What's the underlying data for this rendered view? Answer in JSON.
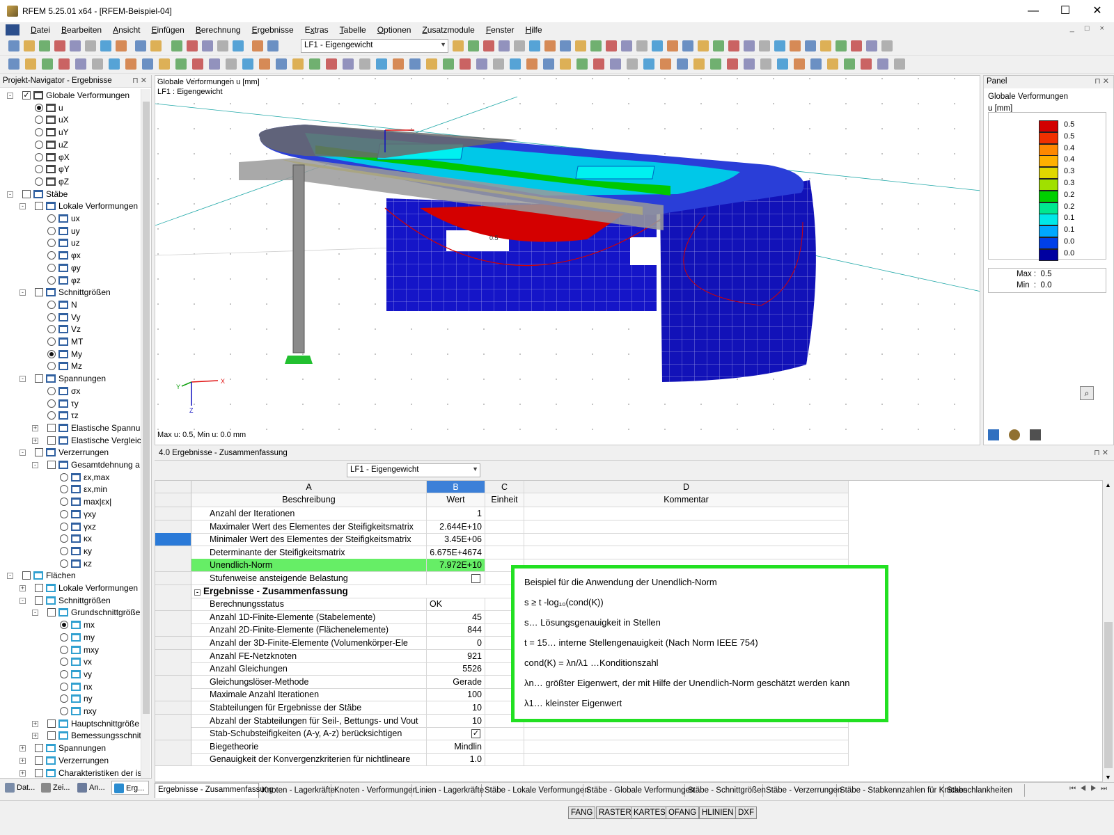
{
  "window": {
    "title": "RFEM 5.25.01 x64 - [RFEM-Beispiel-04]",
    "buttons": [
      "—",
      "☐",
      "✕"
    ]
  },
  "menu": [
    "Datei",
    "Bearbeiten",
    "Ansicht",
    "Einfügen",
    "Berechnung",
    "Ergebnisse",
    "Extras",
    "Tabelle",
    "Optionen",
    "Zusatzmodule",
    "Fenster",
    "Hilfe"
  ],
  "menu_underline": [
    "D",
    "B",
    "A",
    "E",
    "B",
    "E",
    "x",
    "T",
    "O",
    "Z",
    "F",
    "H"
  ],
  "toolbar": {
    "loadcase": "LF1 - Eigengewicht"
  },
  "navigator": {
    "title": "Projekt-Navigator - Ergebnisse",
    "tree": [
      {
        "level": 0,
        "kind": "chk",
        "checked": true,
        "expand": "-",
        "label": "Globale Verformungen",
        "icon": "deform"
      },
      {
        "level": 1,
        "kind": "rad",
        "on": true,
        "label": "u",
        "icon": "deform"
      },
      {
        "level": 1,
        "kind": "rad",
        "label": "uX",
        "icon": "deform"
      },
      {
        "level": 1,
        "kind": "rad",
        "label": "uY",
        "icon": "deform"
      },
      {
        "level": 1,
        "kind": "rad",
        "label": "uZ",
        "icon": "deform"
      },
      {
        "level": 1,
        "kind": "rad",
        "label": "φX",
        "icon": "deform"
      },
      {
        "level": 1,
        "kind": "rad",
        "label": "φY",
        "icon": "deform"
      },
      {
        "level": 1,
        "kind": "rad",
        "label": "φZ",
        "icon": "deform"
      },
      {
        "level": 0,
        "kind": "chk",
        "expand": "-",
        "label": "Stäbe",
        "icon": "member"
      },
      {
        "level": 1,
        "kind": "chk",
        "expand": "-",
        "label": "Lokale Verformungen",
        "icon": "member"
      },
      {
        "level": 2,
        "kind": "rad",
        "label": "ux",
        "icon": "member"
      },
      {
        "level": 2,
        "kind": "rad",
        "label": "uy",
        "icon": "member"
      },
      {
        "level": 2,
        "kind": "rad",
        "label": "uz",
        "icon": "member"
      },
      {
        "level": 2,
        "kind": "rad",
        "label": "φx",
        "icon": "member"
      },
      {
        "level": 2,
        "kind": "rad",
        "label": "φy",
        "icon": "member"
      },
      {
        "level": 2,
        "kind": "rad",
        "label": "φz",
        "icon": "member"
      },
      {
        "level": 1,
        "kind": "chk",
        "expand": "-",
        "label": "Schnittgrößen",
        "icon": "member"
      },
      {
        "level": 2,
        "kind": "rad",
        "label": "N",
        "icon": "member"
      },
      {
        "level": 2,
        "kind": "rad",
        "label": "Vy",
        "icon": "member"
      },
      {
        "level": 2,
        "kind": "rad",
        "label": "Vz",
        "icon": "member"
      },
      {
        "level": 2,
        "kind": "rad",
        "label": "MT",
        "icon": "member"
      },
      {
        "level": 2,
        "kind": "rad",
        "on": true,
        "label": "My",
        "icon": "member"
      },
      {
        "level": 2,
        "kind": "rad",
        "label": "Mz",
        "icon": "member"
      },
      {
        "level": 1,
        "kind": "chk",
        "expand": "-",
        "label": "Spannungen",
        "icon": "member"
      },
      {
        "level": 2,
        "kind": "rad",
        "label": "σx",
        "icon": "member"
      },
      {
        "level": 2,
        "kind": "rad",
        "label": "τy",
        "icon": "member"
      },
      {
        "level": 2,
        "kind": "rad",
        "label": "τz",
        "icon": "member"
      },
      {
        "level": 2,
        "kind": "chk",
        "expand": "+",
        "label": "Elastische Spannun",
        "icon": "member"
      },
      {
        "level": 2,
        "kind": "chk",
        "expand": "+",
        "label": "Elastische Vergleic",
        "icon": "member"
      },
      {
        "level": 1,
        "kind": "chk",
        "expand": "-",
        "label": "Verzerrungen",
        "icon": "member"
      },
      {
        "level": 2,
        "kind": "chk",
        "expand": "-",
        "label": "Gesamtdehnung a",
        "icon": "member"
      },
      {
        "level": 3,
        "kind": "rad",
        "label": "εx,max",
        "icon": "member"
      },
      {
        "level": 3,
        "kind": "rad",
        "label": "εx,min",
        "icon": "member"
      },
      {
        "level": 3,
        "kind": "rad",
        "label": "max|εx|",
        "icon": "member"
      },
      {
        "level": 3,
        "kind": "rad",
        "label": "γxy",
        "icon": "member"
      },
      {
        "level": 3,
        "kind": "rad",
        "label": "γxz",
        "icon": "member"
      },
      {
        "level": 3,
        "kind": "rad",
        "label": "κx",
        "icon": "member"
      },
      {
        "level": 3,
        "kind": "rad",
        "label": "κy",
        "icon": "member"
      },
      {
        "level": 3,
        "kind": "rad",
        "label": "κz",
        "icon": "member"
      },
      {
        "level": 0,
        "kind": "chk",
        "expand": "-",
        "label": "Flächen",
        "icon": "surface"
      },
      {
        "level": 1,
        "kind": "chk",
        "expand": "+",
        "label": "Lokale Verformungen",
        "icon": "surface"
      },
      {
        "level": 1,
        "kind": "chk",
        "expand": "-",
        "label": "Schnittgrößen",
        "icon": "surface"
      },
      {
        "level": 2,
        "kind": "chk",
        "expand": "-",
        "label": "Grundschnittgröße",
        "icon": "surface"
      },
      {
        "level": 3,
        "kind": "rad",
        "on": true,
        "label": "mx",
        "icon": "surface"
      },
      {
        "level": 3,
        "kind": "rad",
        "label": "my",
        "icon": "surface"
      },
      {
        "level": 3,
        "kind": "rad",
        "label": "mxy",
        "icon": "surface"
      },
      {
        "level": 3,
        "kind": "rad",
        "label": "vx",
        "icon": "surface"
      },
      {
        "level": 3,
        "kind": "rad",
        "label": "vy",
        "icon": "surface"
      },
      {
        "level": 3,
        "kind": "rad",
        "label": "nx",
        "icon": "surface"
      },
      {
        "level": 3,
        "kind": "rad",
        "label": "ny",
        "icon": "surface"
      },
      {
        "level": 3,
        "kind": "rad",
        "label": "nxy",
        "icon": "surface"
      },
      {
        "level": 2,
        "kind": "chk",
        "expand": "+",
        "label": "Hauptschnittgröße",
        "icon": "surface"
      },
      {
        "level": 2,
        "kind": "chk",
        "expand": "+",
        "label": "Bemessungsschnit",
        "icon": "surface"
      },
      {
        "level": 1,
        "kind": "chk",
        "expand": "+",
        "label": "Spannungen",
        "icon": "surface"
      },
      {
        "level": 1,
        "kind": "chk",
        "expand": "+",
        "label": "Verzerrungen",
        "icon": "surface"
      },
      {
        "level": 1,
        "kind": "chk",
        "expand": "+",
        "label": "Charakteristiken der is",
        "icon": "surface"
      }
    ],
    "tabs": [
      "Dat...",
      "Zei...",
      "An...",
      "Erg..."
    ]
  },
  "viewport": {
    "title": "Globale Verformungen u [mm]",
    "subtitle": "LF1 : Eigengewicht",
    "footer": "Max u: 0.5, Min u: 0.0 mm",
    "axes": [
      "X",
      "Y",
      "Z"
    ],
    "center_label": "0.5"
  },
  "panel": {
    "title": "Panel",
    "heading": "Globale Verformungen",
    "unit": "u [mm]",
    "legend": [
      {
        "value": "0.5",
        "color": "#d20000"
      },
      {
        "value": "0.5",
        "color": "#f03000"
      },
      {
        "value": "0.4",
        "color": "#ff8800"
      },
      {
        "value": "0.4",
        "color": "#ffb000"
      },
      {
        "value": "0.3",
        "color": "#e0d800"
      },
      {
        "value": "0.3",
        "color": "#a0e000"
      },
      {
        "value": "0.2",
        "color": "#00d000"
      },
      {
        "value": "0.2",
        "color": "#00e890"
      },
      {
        "value": "0.1",
        "color": "#00e8e8"
      },
      {
        "value": "0.1",
        "color": "#00a8ff"
      },
      {
        "value": "0.0",
        "color": "#0040e8"
      },
      {
        "value": "0.0",
        "color": "#0000a0"
      }
    ],
    "max_label": "Max",
    "max_value": "0.5",
    "min_label": "Min",
    "min_value": "0.0"
  },
  "results": {
    "window_title": "4.0 Ergebnisse - Zusammenfassung",
    "loadcase": "LF1 - Eigengewicht",
    "col_letters": [
      "A",
      "B",
      "C",
      "D"
    ],
    "col_headers": [
      "Beschreibung",
      "Wert",
      "Einheit",
      "Kommentar"
    ],
    "rows": [
      {
        "type": "row",
        "desc": "Anzahl der Iterationen",
        "value": "1",
        "align": "right"
      },
      {
        "type": "row",
        "desc": "Maximaler Wert des Elementes der Steifigkeitsmatrix",
        "value": "2.644E+10",
        "align": "right"
      },
      {
        "type": "row",
        "desc": "Minimaler Wert des Elementes der Steifigkeitsmatrix",
        "value": "3.45E+06",
        "align": "right",
        "selected": true
      },
      {
        "type": "row",
        "desc": "Determinante der Steifigkeitsmatrix",
        "value": "6.675E+4674",
        "align": "right"
      },
      {
        "type": "row",
        "desc": "Unendlich-Norm",
        "value": "7.972E+10",
        "align": "right",
        "highlight": true
      },
      {
        "type": "checkbox",
        "desc": "Stufenweise ansteigende Belastung",
        "checked": false
      },
      {
        "type": "section",
        "desc": "Ergebnisse - Zusammenfassung"
      },
      {
        "type": "row",
        "desc": "Berechnungsstatus",
        "value": "OK",
        "align": "left"
      },
      {
        "type": "row",
        "desc": "Anzahl 1D-Finite-Elemente (Stabelemente)",
        "value": "45",
        "align": "right"
      },
      {
        "type": "row",
        "desc": "Anzahl 2D-Finite-Elemente (Flächenelemente)",
        "value": "844",
        "align": "right"
      },
      {
        "type": "row",
        "desc": "Anzahl der 3D-Finite-Elemente (Volumenkörper-Ele",
        "value": "0",
        "align": "right"
      },
      {
        "type": "row",
        "desc": "Anzahl FE-Netzknoten",
        "value": "921",
        "align": "right"
      },
      {
        "type": "row",
        "desc": "Anzahl Gleichungen",
        "value": "5526",
        "align": "right"
      },
      {
        "type": "row",
        "desc": "Gleichungslöser-Methode",
        "value": "Gerade",
        "align": "right"
      },
      {
        "type": "row",
        "desc": "Maximale Anzahl Iterationen",
        "value": "100",
        "align": "right"
      },
      {
        "type": "row",
        "desc": "Stabteilungen für Ergebnisse der Stäbe",
        "value": "10",
        "align": "right"
      },
      {
        "type": "row",
        "desc": "Abzahl der Stabteilungen für Seil-, Bettungs- und Vout",
        "value": "10",
        "align": "right"
      },
      {
        "type": "checkbox",
        "desc": "Stab-Schubsteifigkeiten (A-y, A-z) berücksichtigen",
        "checked": true
      },
      {
        "type": "row",
        "desc": "Biegetheorie",
        "value": "Mindlin",
        "align": "right"
      },
      {
        "type": "row",
        "desc": "Genauigkeit der Konvergenzkriterien für nichtlineare",
        "value": "1.0",
        "align": "right"
      }
    ],
    "tabs": [
      "Ergebnisse - Zusammenfassung",
      "Knoten - Lagerkräfte",
      "Knoten - Verformungen",
      "Linien - Lagerkräfte",
      "Stäbe - Lokale Verformungen",
      "Stäbe - Globale Verformungen",
      "Stäbe - Schnittgrößen",
      "Stäbe - Verzerrungen",
      "Stäbe - Stabkennzahlen für Knicken",
      "Stabschlankheiten"
    ]
  },
  "annotation": {
    "lines": [
      "Beispiel für die Anwendung der Unendlich-Norm",
      "s ≥ t -log₁₀(cond(K))",
      "s… Lösungsgenauigkeit in Stellen",
      "t = 15… interne Stellengenauigkeit (Nach Norm IEEE 754)",
      "cond(K) = λn/λ1 …Konditionszahl",
      "λn… größter Eigenwert, der mit Hilfe der Unendlich-Norm geschätzt werden kann",
      "λ1… kleinster Eigenwert"
    ]
  },
  "statusbar": [
    "FANG",
    "RASTER",
    "KARTES",
    "OFANG",
    "HLINIEN",
    "DXF"
  ]
}
